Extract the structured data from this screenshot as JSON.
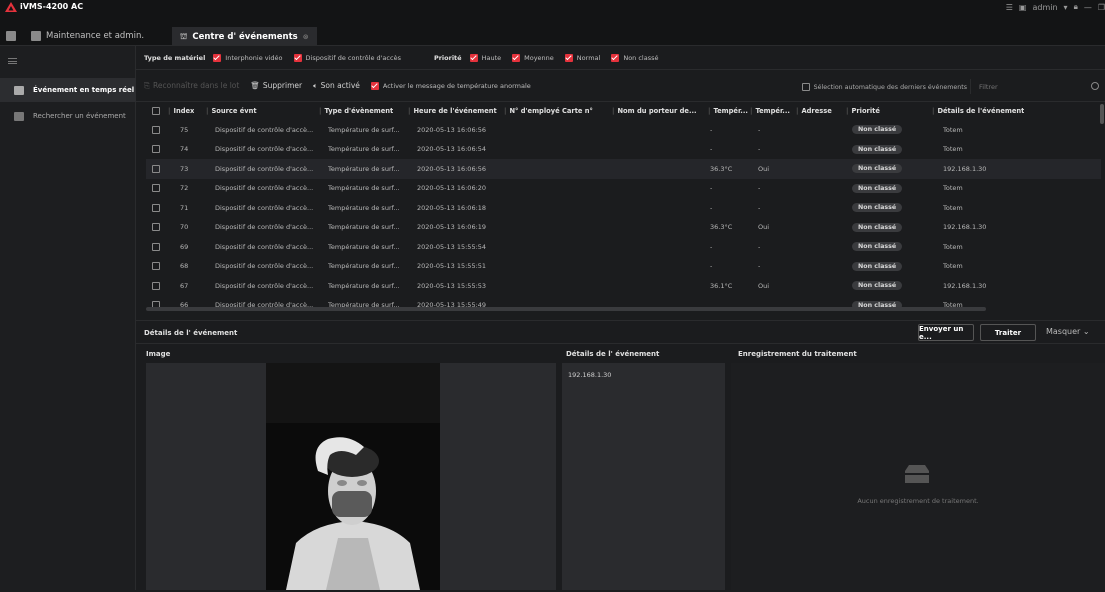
{
  "app": {
    "title": "iVMS-4200 AC",
    "user": "admin"
  },
  "tabs": [
    {
      "label": "Maintenance et admin."
    },
    {
      "label": "Centre d' événements"
    }
  ],
  "sidebar": {
    "items": [
      {
        "label": "Événement en temps réel"
      },
      {
        "label": "Rechercher un événement"
      }
    ]
  },
  "filters": {
    "material_label": "Type de matériel",
    "material_options": [
      {
        "label": "Interphonie vidéo",
        "checked": true
      },
      {
        "label": "Dispositif de contrôle d'accès",
        "checked": true
      }
    ],
    "priority_label": "Priorité",
    "priority_options": [
      {
        "label": "Haute",
        "checked": true
      },
      {
        "label": "Moyenne",
        "checked": true
      },
      {
        "label": "Normal",
        "checked": true
      },
      {
        "label": "Non classé",
        "checked": true
      }
    ]
  },
  "toolbar": {
    "acknowledge": "Reconnaître dans le lot",
    "delete": "Supprimer",
    "sound": "Son activé",
    "temp_msg": "Activer le message de température anormale",
    "auto_select": "Sélection automatique des derniers événements",
    "filter_placeholder": "Filtrer"
  },
  "table": {
    "headers": [
      "Index",
      "Source évnt",
      "Type d'évènement",
      "Heure de l'événement",
      "N° d'employé",
      "Carte n°",
      "Nom du porteur de...",
      "Tempér...",
      "Tempér...",
      "Adresse",
      "Priorité",
      "Détails de l'événement"
    ],
    "rows": [
      {
        "index": "75",
        "source": "Dispositif de contrôle d'accè...",
        "type": "Température de surf...",
        "time": "2020-05-13 16:06:56",
        "temp": "-",
        "abn": "-",
        "priority": "Non classé",
        "details": "Totem"
      },
      {
        "index": "74",
        "source": "Dispositif de contrôle d'accè...",
        "type": "Température de surf...",
        "time": "2020-05-13 16:06:54",
        "temp": "-",
        "abn": "-",
        "priority": "Non classé",
        "details": "Totem"
      },
      {
        "index": "73",
        "source": "Dispositif de contrôle d'accè...",
        "type": "Température de surf...",
        "time": "2020-05-13 16:06:56",
        "temp": "36.3°C",
        "abn": "Oui",
        "priority": "Non classé",
        "details": "192.168.1.30"
      },
      {
        "index": "72",
        "source": "Dispositif de contrôle d'accè...",
        "type": "Température de surf...",
        "time": "2020-05-13 16:06:20",
        "temp": "-",
        "abn": "-",
        "priority": "Non classé",
        "details": "Totem"
      },
      {
        "index": "71",
        "source": "Dispositif de contrôle d'accè...",
        "type": "Température de surf...",
        "time": "2020-05-13 16:06:18",
        "temp": "-",
        "abn": "-",
        "priority": "Non classé",
        "details": "Totem"
      },
      {
        "index": "70",
        "source": "Dispositif de contrôle d'accè...",
        "type": "Température de surf...",
        "time": "2020-05-13 16:06:19",
        "temp": "36.3°C",
        "abn": "Oui",
        "priority": "Non classé",
        "details": "192.168.1.30"
      },
      {
        "index": "69",
        "source": "Dispositif de contrôle d'accè...",
        "type": "Température de surf...",
        "time": "2020-05-13 15:55:54",
        "temp": "-",
        "abn": "-",
        "priority": "Non classé",
        "details": "Totem"
      },
      {
        "index": "68",
        "source": "Dispositif de contrôle d'accè...",
        "type": "Température de surf...",
        "time": "2020-05-13 15:55:51",
        "temp": "-",
        "abn": "-",
        "priority": "Non classé",
        "details": "Totem"
      },
      {
        "index": "67",
        "source": "Dispositif de contrôle d'accè...",
        "type": "Température de surf...",
        "time": "2020-05-13 15:55:53",
        "temp": "36.1°C",
        "abn": "Oui",
        "priority": "Non classé",
        "details": "192.168.1.30"
      },
      {
        "index": "66",
        "source": "Dispositif de contrôle d'accè...",
        "type": "Température de surf...",
        "time": "2020-05-13 15:55:49",
        "temp": "",
        "abn": "",
        "priority": "Non classé",
        "details": "Totem"
      }
    ]
  },
  "detail": {
    "title": "Détails de l' événement",
    "send_button": "Envoyer un e...",
    "treat_button": "Traiter",
    "hide_button": "Masquer",
    "image_title": "Image",
    "details_title": "Détails de l' événement",
    "details_value": "192.168.1.30",
    "processing_title": "Enregistrement du traitement",
    "processing_empty": "Aucun enregistrement de traitement."
  },
  "colors": {
    "accent": "#e5323c",
    "background": "#1b1c1e",
    "panel": "#2a2b2e"
  }
}
